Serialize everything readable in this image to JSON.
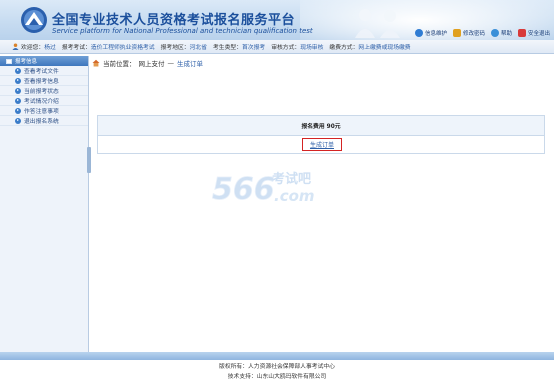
{
  "header": {
    "title": "全国专业技术人员资格考试报名服务平台",
    "subtitle": "Service platform for National Professional and technician qualification test",
    "links": [
      {
        "label": "信息维护",
        "icon": "info-maintain-icon",
        "color": "#2f7cd3"
      },
      {
        "label": "修改密码",
        "icon": "lock-icon",
        "color": "#e0a020"
      },
      {
        "label": "帮助",
        "icon": "help-icon",
        "color": "#3a8fd8"
      },
      {
        "label": "安全退出",
        "icon": "logout-icon",
        "color": "#d83a3a"
      }
    ]
  },
  "info": {
    "welcome_label": "欢迎您：",
    "welcome_value": "杨过",
    "exam_label": "报考考试：",
    "exam_value": "造价工程师执业资格考试",
    "region_label": "报考地区：",
    "region_value": "河北省",
    "type_label": "考生类型：",
    "type_value": "首次报考",
    "review_label": "审核方式：",
    "review_value": "现场审核",
    "pay_label": "缴费方式：",
    "pay_value": "网上缴费或现场缴费"
  },
  "sidebar": {
    "header": "报考信息",
    "items": [
      {
        "label": "查看考试文件"
      },
      {
        "label": "查看报考信息"
      },
      {
        "label": "当前报考状态"
      },
      {
        "label": "考试情况介绍"
      },
      {
        "label": "作答注意事项"
      },
      {
        "label": "退出报名系统"
      }
    ]
  },
  "breadcrumb": {
    "prefix": "当前位置：",
    "section": "网上支付",
    "sep": "—",
    "page": "生成订单"
  },
  "main": {
    "fee_text": "报名费用  90元",
    "order_button": "生成订单"
  },
  "watermark": {
    "number": "566",
    "brand": "考试吧",
    "domain": ".com"
  },
  "footer": {
    "owner": "版权所有：人力资源社会保障部人事考试中心",
    "support": "技术支持：山东山大鸥玛软件有限公司"
  },
  "colors": {
    "brand_blue": "#1b4f9c",
    "link_blue": "#2d5fa8",
    "highlight_red": "#d42424"
  }
}
